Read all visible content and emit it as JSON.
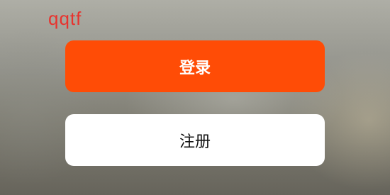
{
  "watermark": {
    "text": "qqtf",
    "color": "#e8332e"
  },
  "buttons": {
    "login_label": "登录",
    "register_label": "注册"
  },
  "colors": {
    "login_bg": "#ff4c06",
    "register_bg": "#ffffff"
  }
}
